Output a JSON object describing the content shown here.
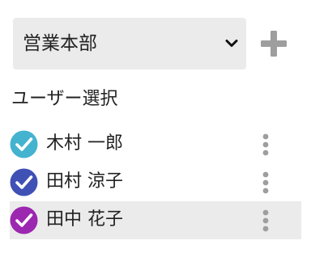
{
  "department": {
    "selected": "営業本部",
    "icon": "chevron-down-icon"
  },
  "add_button": {
    "icon": "plus-icon"
  },
  "section": {
    "title": "ユーザー選択"
  },
  "users": [
    {
      "name": "木村 一郎",
      "checked": true,
      "color": "#44b3cf",
      "selected": false
    },
    {
      "name": "田村 涼子",
      "checked": true,
      "color": "#3f51b5",
      "selected": false
    },
    {
      "name": "田中 花子",
      "checked": true,
      "color": "#9c27b0",
      "selected": true
    }
  ],
  "colors": {
    "select_bg": "#ebebeb",
    "selected_row_bg": "#ebebeb",
    "icon_gray": "#9e9e9e",
    "text": "#222222"
  }
}
